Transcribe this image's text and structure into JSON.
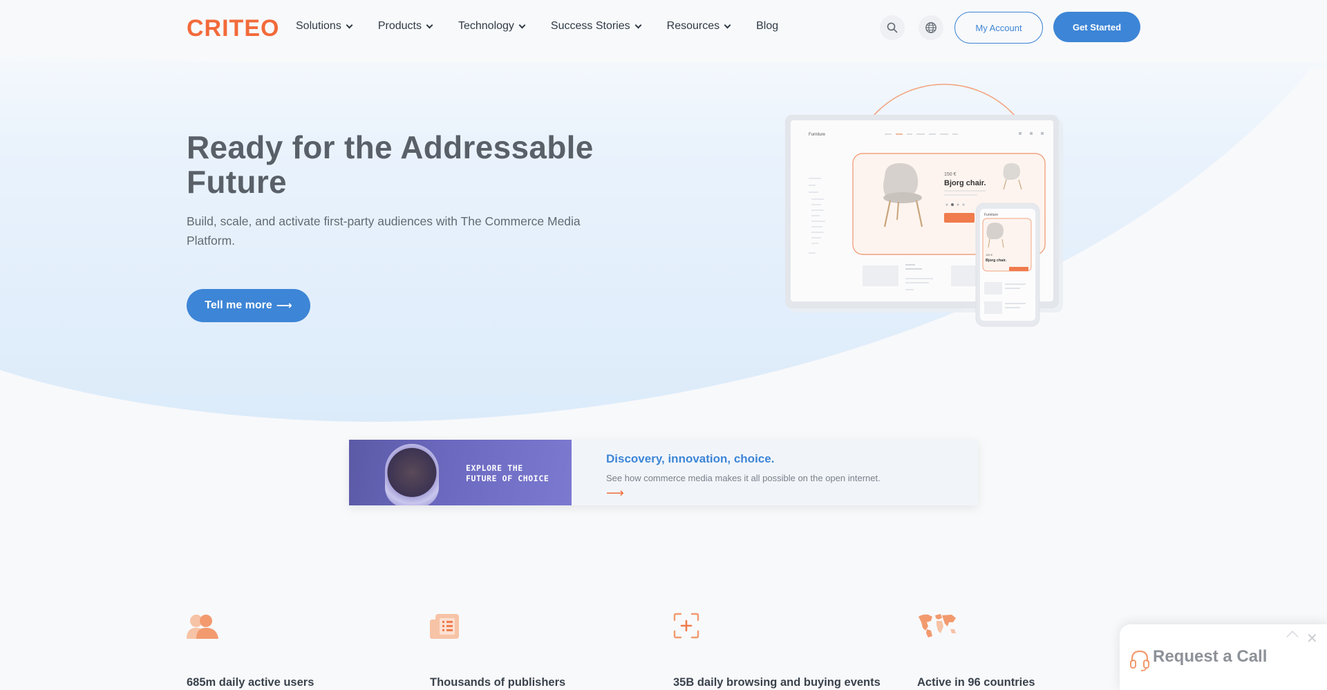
{
  "header": {
    "logo": "CRITEO",
    "nav": [
      {
        "label": "Solutions",
        "has_dropdown": true
      },
      {
        "label": "Products",
        "has_dropdown": true
      },
      {
        "label": "Technology",
        "has_dropdown": true
      },
      {
        "label": "Success Stories",
        "has_dropdown": true
      },
      {
        "label": "Resources",
        "has_dropdown": true
      },
      {
        "label": "Blog",
        "has_dropdown": false
      }
    ],
    "search_icon": "search-icon",
    "language_icon": "globe-icon",
    "my_account_label": "My Account",
    "get_started_label": "Get Started"
  },
  "hero": {
    "title": "Ready for the Addressable Future",
    "subtitle": "Build, scale, and activate first-party audiences with The Commerce Media Platform.",
    "cta_label": "Tell me more",
    "cta_arrow": "⟶",
    "illustration": {
      "brand": "Furniture",
      "product_price": "150 €",
      "product_name": "Bjorg chair.",
      "mobile_price": "150 €",
      "mobile_product_name": "Bjorg chair."
    }
  },
  "promo": {
    "image_tag_line1": "EXPLORE THE",
    "image_tag_line2": "FUTURE OF CHOICE",
    "title": "Discovery, innovation, choice.",
    "description": "See how commerce media makes it all possible on the open internet.",
    "arrow": "⟶"
  },
  "stats": [
    {
      "icon": "users-icon",
      "label": "685m daily active users"
    },
    {
      "icon": "publishers-icon",
      "label": "Thousands of publishers"
    },
    {
      "icon": "focus-plus-icon",
      "label": "35B daily browsing and buying events"
    },
    {
      "icon": "world-map-icon",
      "label": "Active in 96 countries"
    }
  ],
  "call_widget": {
    "label": "Request a Call",
    "close": "✕"
  },
  "colors": {
    "brand_orange": "#f26a3a",
    "brand_blue": "#3d85d6",
    "hero_bg_light": "#e6f0fb"
  }
}
